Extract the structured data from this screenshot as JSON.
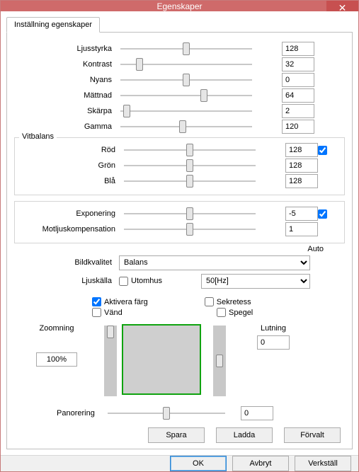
{
  "window": {
    "title": "Egenskaper",
    "close_glyph": "✕"
  },
  "tab": {
    "label": "Inställning egenskaper"
  },
  "sliders": {
    "brightness": {
      "label": "Ljusstyrka",
      "value": "128"
    },
    "contrast": {
      "label": "Kontrast",
      "value": "32"
    },
    "hue": {
      "label": "Nyans",
      "value": "0"
    },
    "saturation": {
      "label": "Mättnad",
      "value": "64"
    },
    "sharpness": {
      "label": "Skärpa",
      "value": "2"
    },
    "gamma": {
      "label": "Gamma",
      "value": "120"
    }
  },
  "whitebalance": {
    "legend": "Vitbalans",
    "red": {
      "label": "Röd",
      "value": "128"
    },
    "green": {
      "label": "Grön",
      "value": "128"
    },
    "blue": {
      "label": "Blå",
      "value": "128"
    },
    "auto_checked": true
  },
  "exposure": {
    "exposure": {
      "label": "Exponering",
      "value": "-5"
    },
    "backlight": {
      "label": "Motljuskompensation",
      "value": "1"
    },
    "auto_checked": true,
    "auto_label": "Auto"
  },
  "quality": {
    "label": "Bildkvalitet",
    "selected": "Balans"
  },
  "lightsource": {
    "label": "Ljuskälla",
    "outdoor_label": "Utomhus",
    "freq_selected": "50[Hz]"
  },
  "checks": {
    "color_on": {
      "label": "Aktivera färg",
      "checked": true
    },
    "privacy": {
      "label": "Sekretess",
      "checked": false
    },
    "flip": {
      "label": "Vänd",
      "checked": false
    },
    "mirror": {
      "label": "Spegel",
      "checked": false
    }
  },
  "zoom": {
    "label": "Zoomning",
    "value": "100%"
  },
  "tilt": {
    "label": "Lutning",
    "value": "0"
  },
  "pan": {
    "label": "Panorering",
    "value": "0"
  },
  "buttons": {
    "save": "Spara",
    "load": "Ladda",
    "default": "Förvalt",
    "ok": "OK",
    "cancel": "Avbryt",
    "apply": "Verkställ"
  }
}
